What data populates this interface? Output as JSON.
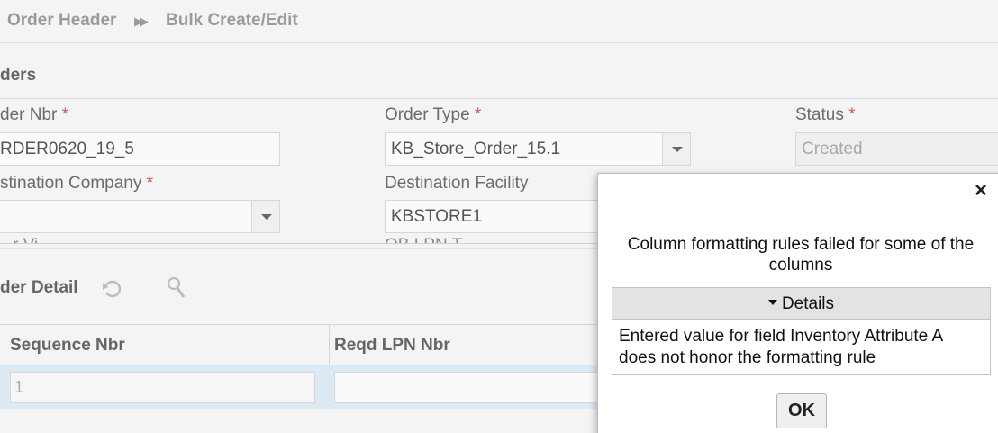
{
  "breadcrumb": {
    "items": [
      "Order Header",
      "Bulk Create/Edit"
    ],
    "separator": "▶▶"
  },
  "headers_section": {
    "title": "ders"
  },
  "fields": {
    "order_nbr": {
      "label": "der Nbr",
      "required": "*",
      "value": "RDER0620_19_5"
    },
    "order_type": {
      "label": "Order Type",
      "required": "*",
      "value": "KB_Store_Order_15.1"
    },
    "status": {
      "label": "Status",
      "required": "*",
      "value": "Created"
    },
    "destination_company": {
      "label": "stination Company",
      "required": "*",
      "value": ""
    },
    "destination_facility": {
      "label": "Destination Facility",
      "value": "KBSTORE1"
    },
    "partial_label_1": "r Vi",
    "partial_label_2": "OB LPN T"
  },
  "detail_section": {
    "title": "der Detail",
    "refresh_icon": "refresh-icon",
    "search_icon": "search-icon"
  },
  "grid": {
    "columns": [
      "Sequence Nbr",
      "Reqd LPN Nbr"
    ],
    "rows": [
      {
        "sequence_nbr": "1",
        "reqd_lpn_nbr": ""
      }
    ]
  },
  "modal": {
    "close_glyph": "×",
    "message": "Column formatting rules failed for some of the columns",
    "details_label": "Details",
    "details_text": "Entered value for field Inventory Attribute A does not honor the formatting rule",
    "ok_label": "OK"
  },
  "colors": {
    "required": "#d9534f",
    "selected_row": "#dde9f3",
    "background": "#f4f4f4"
  }
}
